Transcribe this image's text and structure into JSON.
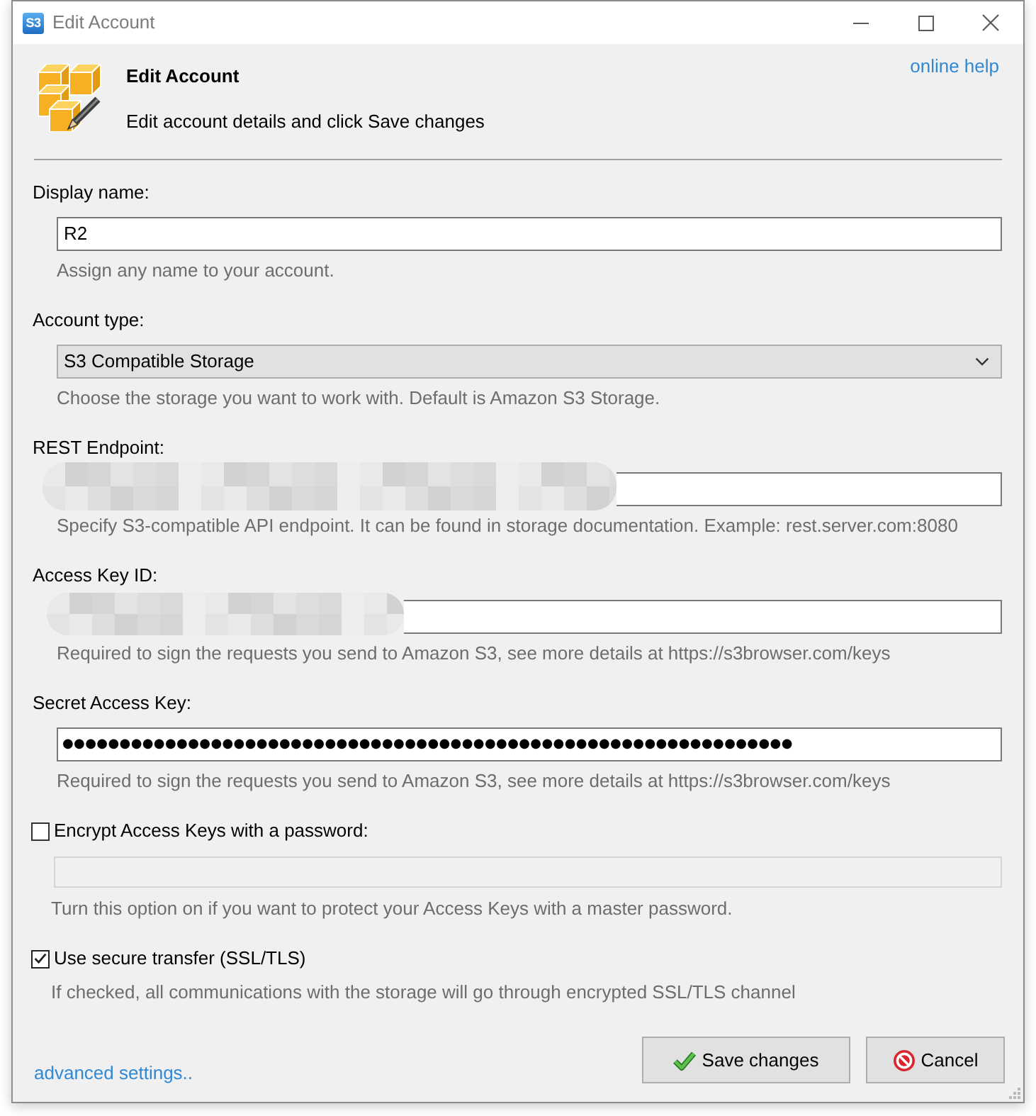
{
  "window": {
    "icon_text": "S3",
    "title": "Edit Account"
  },
  "header": {
    "title": "Edit Account",
    "subtitle": "Edit account details and click Save changes",
    "help_link": "online help"
  },
  "fields": [
    {
      "kind": "text",
      "label": "Display name:",
      "value": "R2",
      "redacted": false,
      "hint": "Assign any name to your account."
    },
    {
      "kind": "select",
      "label": "Account type:",
      "value": "S3 Compatible Storage",
      "redacted": false,
      "hint": "Choose the storage you want to work with. Default is Amazon S3 Storage."
    },
    {
      "kind": "text",
      "label": "REST Endpoint:",
      "redacted": true,
      "hint": "Specify S3-compatible API endpoint. It can be found in storage documentation. Example: rest.server.com:8080"
    },
    {
      "kind": "text",
      "label": "Access Key ID:",
      "redacted": true,
      "hint": "Required to sign the requests you send to Amazon S3, see more details at https://s3browser.com/keys"
    },
    {
      "kind": "password",
      "label": "Secret Access Key:",
      "value": "●●●●●●●●●●●●●●●●●●●●●●●●●●●●●●●●●●●●●●●●●●●●●●●●●●●●●●●●●●●●●●●●",
      "redacted": false,
      "hint": "Required to sign the requests you send to Amazon S3, see more details at https://s3browser.com/keys"
    }
  ],
  "options": [
    {
      "label": "Encrypt Access Keys with a password:",
      "checked": false,
      "password_field": {
        "disabled": true
      },
      "hint": "Turn this option on if you want to protect your Access Keys with a master password."
    },
    {
      "label": "Use secure transfer (SSL/TLS)",
      "checked": true,
      "hint": "If checked, all communications with the storage will go through encrypted SSL/TLS channel"
    }
  ],
  "footer": {
    "link": "advanced settings..",
    "buttons": [
      {
        "kind": "save",
        "label": "Save changes"
      },
      {
        "kind": "cancel",
        "label": "Cancel"
      }
    ]
  }
}
